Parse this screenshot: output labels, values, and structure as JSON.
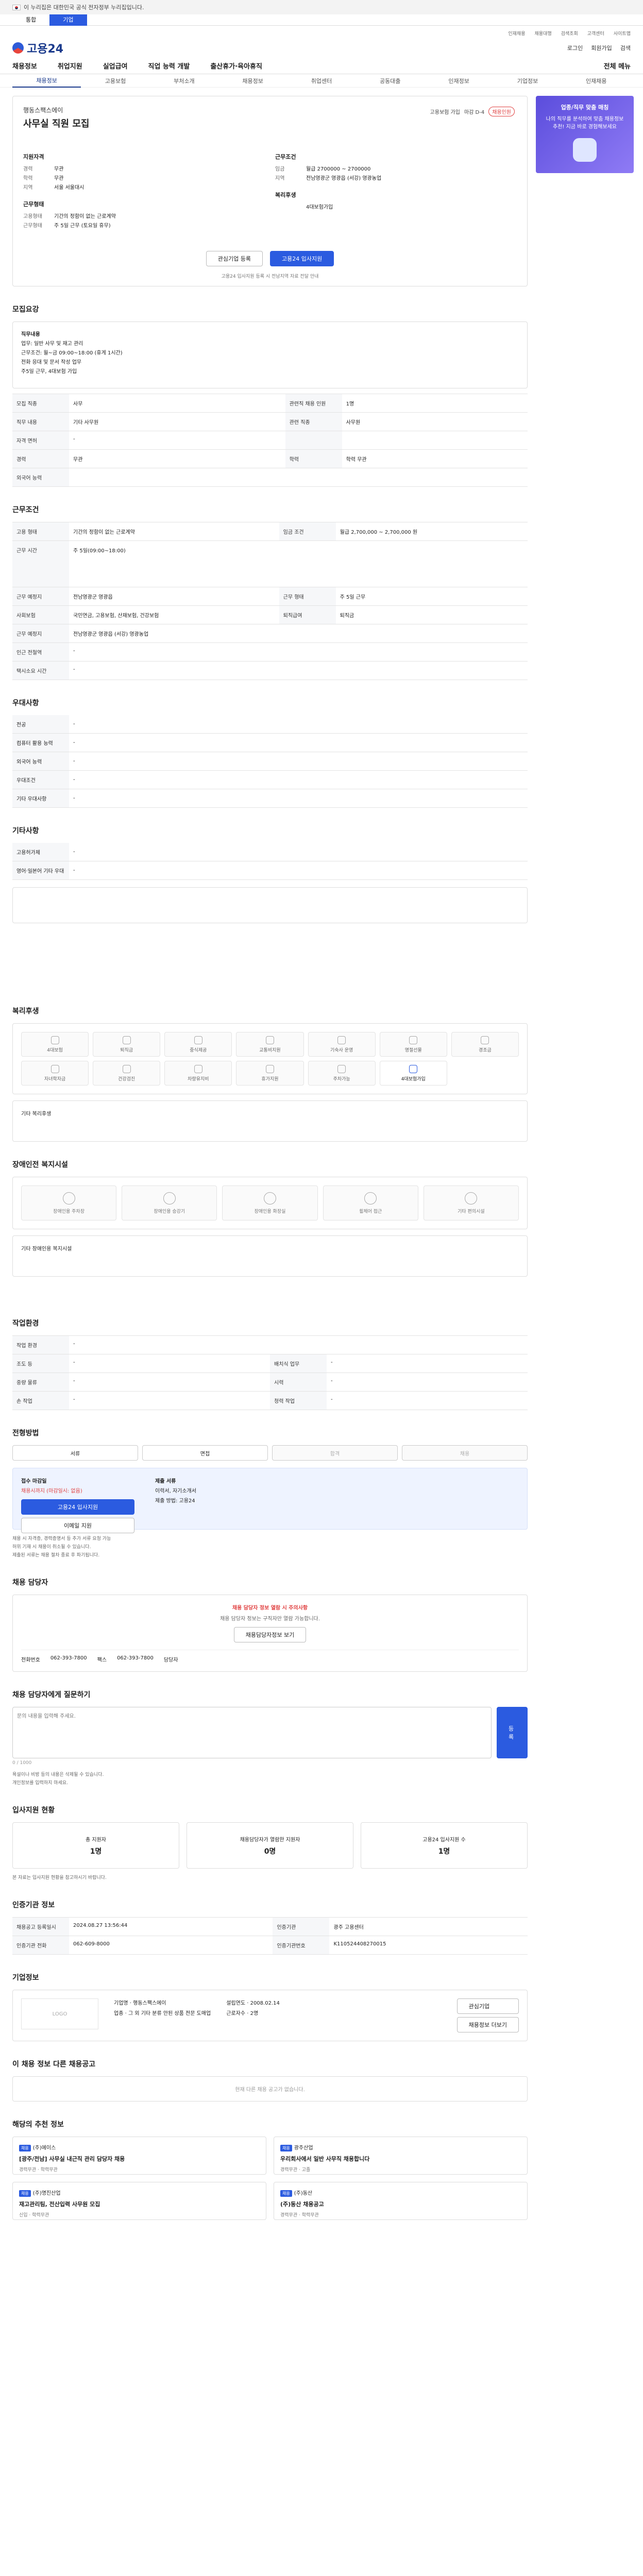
{
  "gov_bar": {
    "text": "이 누리집은 대한민국 공식 전자정부 누리집입니다."
  },
  "site_tabs": [
    "통합",
    "기업"
  ],
  "topbar": [
    "인재채용",
    "채용대행",
    "검색조회",
    "고객센터",
    "사이트맵"
  ],
  "logo": "고용24",
  "header_right": {
    "login": "로그인",
    "join": "회원가입",
    "search": "검색"
  },
  "gnb": {
    "items": [
      "채용정보",
      "취업지원",
      "실업급여",
      "직업 능력 개발",
      "출산휴가·육아휴직"
    ],
    "all_menu": "전체 메뉴"
  },
  "subnav": [
    "채용정보",
    "고용보험",
    "부처소개",
    "채용정보",
    "취업센터",
    "공동대출",
    "인재정보",
    "기업정보",
    "인재채용"
  ],
  "banner": {
    "title": "업종/직무 맞춤 매칭",
    "text": "나의 직무를 분석하여 맞춤 채용정보 추천! 지금 바로 경험해보세요"
  },
  "job": {
    "company": "행동스팩스에이",
    "title": "사무실 직원 모집",
    "badge_label": "고용보험 가입",
    "badge_days": "마감 D-4",
    "badge_hot": "채용인원",
    "qual_title": "지원자격",
    "qual": [
      {
        "k": "경력",
        "v": "무관"
      },
      {
        "k": "학력",
        "v": "무관"
      },
      {
        "k": "지역",
        "v": "서울 서울대시"
      }
    ],
    "cond_title": "근무조건",
    "cond": [
      {
        "k": "임금",
        "v": "월급 2700000 ~ 2700000"
      },
      {
        "k": "지역",
        "v": "전남영광군 영광읍 (서강) 영광농업"
      }
    ],
    "env_title": "근무형태",
    "env": [
      {
        "k": "고용형태",
        "v": "기간의 정함이 없는 근로계약"
      },
      {
        "k": "근무형태",
        "v": "주 5일 근무 (토요일 휴무)"
      }
    ],
    "welfare_title": "복리후생",
    "welfare": [
      {
        "k": "",
        "v": "4대보험가입"
      }
    ],
    "btn_interest": "관심기업 등록",
    "btn_apply": "고용24 입사지원",
    "note": "고용24 입사지원 등록 시 전남지역 자료 전달 안내"
  },
  "sections": {
    "recruit": "모집요강",
    "worksite": "근무조건",
    "pref": "우대사항",
    "other": "기타사항",
    "welfare": "복리후생",
    "disabled": "장애인전 복지시설",
    "env": "작업환경",
    "process": "전형방법",
    "manager": "채용 담당자",
    "question": "채용 담당자에게 질문하기",
    "status": "입사지원 현황",
    "agency": "인증기관 정보",
    "company": "기업정보",
    "similar": "이 채용 정보 다른 채용공고",
    "related": "해당의 추천 정보"
  },
  "recruit_desc": {
    "title": "직무내용",
    "lines": [
      "업무: 일반 사무 및 재고 관리",
      "근무조건: 월~금 09:00~18:00 (휴게 1시간)",
      "전화 응대 및 문서 작성 업무",
      "주5일 근무, 4대보험 가입"
    ]
  },
  "recruit_rows": [
    {
      "k": "모집 직종",
      "v": "사무",
      "k2": "관련직 채용 인원",
      "v2": "1명"
    },
    {
      "k": "직무 내용",
      "v": "기타 사무원",
      "k2": "관련 직종",
      "v2": "사무원"
    },
    {
      "k": "자격 면허",
      "v": "-",
      "k2": "",
      "v2": ""
    },
    {
      "k": "경력",
      "v": "무관",
      "k2": "학력",
      "v2": "학력 무관"
    },
    {
      "k": "외국어 능력",
      "v": "",
      "k2": "",
      "v2": ""
    }
  ],
  "work_rows": [
    {
      "k": "고용 형태",
      "v": "기간의 정함이 없는 근로계약",
      "k2": "임금 조건",
      "v2": "월급 2,700,000 ~ 2,700,000 원"
    },
    {
      "k": "근무 시간",
      "v": "주 5일(09:00~18:00)",
      "k2": "",
      "v2": ""
    },
    {
      "k": "근무 예정지",
      "v": "전남영광군 영광읍",
      "k2": "근무 형태",
      "v2": "주 5일 근무"
    },
    {
      "k": "사회보험",
      "v": "국민연금, 고용보험, 산재보험, 건강보험",
      "k2": "퇴직급여",
      "v2": "퇴직금"
    },
    {
      "k": "근무 예정지",
      "v": "전남영광군 영광읍 (서강) 영광농업",
      "k2": "",
      "v2": ""
    },
    {
      "k": "인근 전철역",
      "v": "-",
      "k2": "",
      "v2": ""
    },
    {
      "k": "택시소요 시간",
      "v": "-",
      "k2": "",
      "v2": ""
    }
  ],
  "pref_rows": [
    {
      "k": "전공",
      "v": "-"
    },
    {
      "k": "컴퓨터 활용 능력",
      "v": "-"
    },
    {
      "k": "외국어 능력",
      "v": "-"
    },
    {
      "k": "우대조건",
      "v": "-"
    },
    {
      "k": "기타 우대사항",
      "v": "-"
    }
  ],
  "other_rows": [
    {
      "k": "고용허가제",
      "v": "-"
    },
    {
      "k": "영어·일본어 기타 우대",
      "v": "-"
    }
  ],
  "welfare_items": [
    "4대보험",
    "퇴직금",
    "중식제공",
    "교통비지원",
    "기숙사 운영",
    "명절선물",
    "경조금",
    "자녀학자금",
    "건강검진",
    "차량유지비",
    "휴가지원",
    "주차가능",
    "4대보험가입"
  ],
  "welfare_note": "기타 복리후생",
  "disabled_items": [
    "장애인용 주차장",
    "장애인용 승강기",
    "장애인용 화장실",
    "휠체어 접근",
    "기타 편의시설"
  ],
  "disabled_note": "기타 장애인용 복지시설",
  "env_rows": [
    {
      "k": "작업 환경",
      "v": "-",
      "k2": "",
      "v2": ""
    },
    {
      "k": "조도 등",
      "v": "-",
      "k2": "배치식 업무",
      "v2": "-"
    },
    {
      "k": "중량 물류",
      "v": "-",
      "k2": "시력",
      "v2": "-"
    },
    {
      "k": "손 작업",
      "v": "-",
      "k2": "청력 작업",
      "v2": "-"
    }
  ],
  "process_steps": [
    "서류",
    "면접",
    "합격",
    "채용"
  ],
  "apply": {
    "method_label": "접수 마감일",
    "deadline": "채용시까지 (마감일시: 없음)",
    "apply_btn": "고용24 입사지원",
    "email_btn": "이메일 지원",
    "docs_label": "제출 서류",
    "docs": "이력서, 자기소개서",
    "docs2": "제출 방법: 고용24"
  },
  "notes": [
    "채용 시 자격증, 경력증명서 등 추가 서류 요청 가능",
    "허위 기재 시 채용이 취소될 수 있습니다.",
    "제출된 서류는 채용 절차 종료 후 파기됩니다."
  ],
  "manager": {
    "warn": "채용 담당자 정보 열람 시 주의사항",
    "text": "채용 담당자 정보는 구직자만 열람 가능합니다.",
    "btn": "채용담당자정보 보기",
    "tel_label": "전화번호",
    "tel": "062-393-7800",
    "fax_label": "팩스",
    "fax": "062-393-7800",
    "name_label": "담당자"
  },
  "question": {
    "placeholder": "문의 내용을 입력해 주세요.",
    "count": "0 / 1000",
    "submit": "등록"
  },
  "q_notes": [
    "욕설이나 비방 등의 내용은 삭제될 수 있습니다.",
    "개인정보를 입력하지 마세요."
  ],
  "status": [
    {
      "label": "총 지원자",
      "value": "1명"
    },
    {
      "label": "채용담당자가 열람한 지원자",
      "value": "0명"
    },
    {
      "label": "고용24 입사지원 수",
      "value": "1명"
    }
  ],
  "status_note": "본 자료는 입사지원 현황을 참고하시기 바랍니다.",
  "agency_rows": [
    {
      "k": "채용공고 등록일시",
      "v": "2024.08.27 13:56:44",
      "k2": "인증기관",
      "v2": "광주 고용센터"
    },
    {
      "k": "인증기관 전화",
      "v": "062-609-8000",
      "k2": "인증기관번호",
      "v2": "K110524408270015"
    }
  ],
  "company_info": {
    "logo": "LOGO",
    "name_label": "기업명",
    "name": "행동스팩스에이",
    "size_label": "업종",
    "size": "그 외 기타 분류 안된 상품 전문 도매업",
    "emp_label": "근로자수",
    "emp": "2명",
    "year_label": "설립연도",
    "year": "2008.02.14",
    "btn1": "관심기업",
    "btn2": "채용정보 더보기"
  },
  "similar_empty": "현재 다른 채용 공고가 없습니다.",
  "related_cards": [
    {
      "tag": "채용",
      "company": "(주)에이스",
      "title": "[광주/전남] 사무실 내근직 관리 담당자 채용",
      "meta": "경력무관 · 학력무관"
    },
    {
      "tag": "채용",
      "company": "광주산업",
      "title": "우리회사에서 일반 사무직 채용합니다",
      "meta": "경력무관 · 고졸"
    },
    {
      "tag": "채용",
      "company": "(주)명진산업",
      "title": "재고관리팀, 전산입력 사무원 모집",
      "meta": "신입 · 학력무관"
    },
    {
      "tag": "채용",
      "company": "(주)동산",
      "title": "(주)동산 채용공고",
      "meta": "경력무관 · 학력무관"
    }
  ]
}
